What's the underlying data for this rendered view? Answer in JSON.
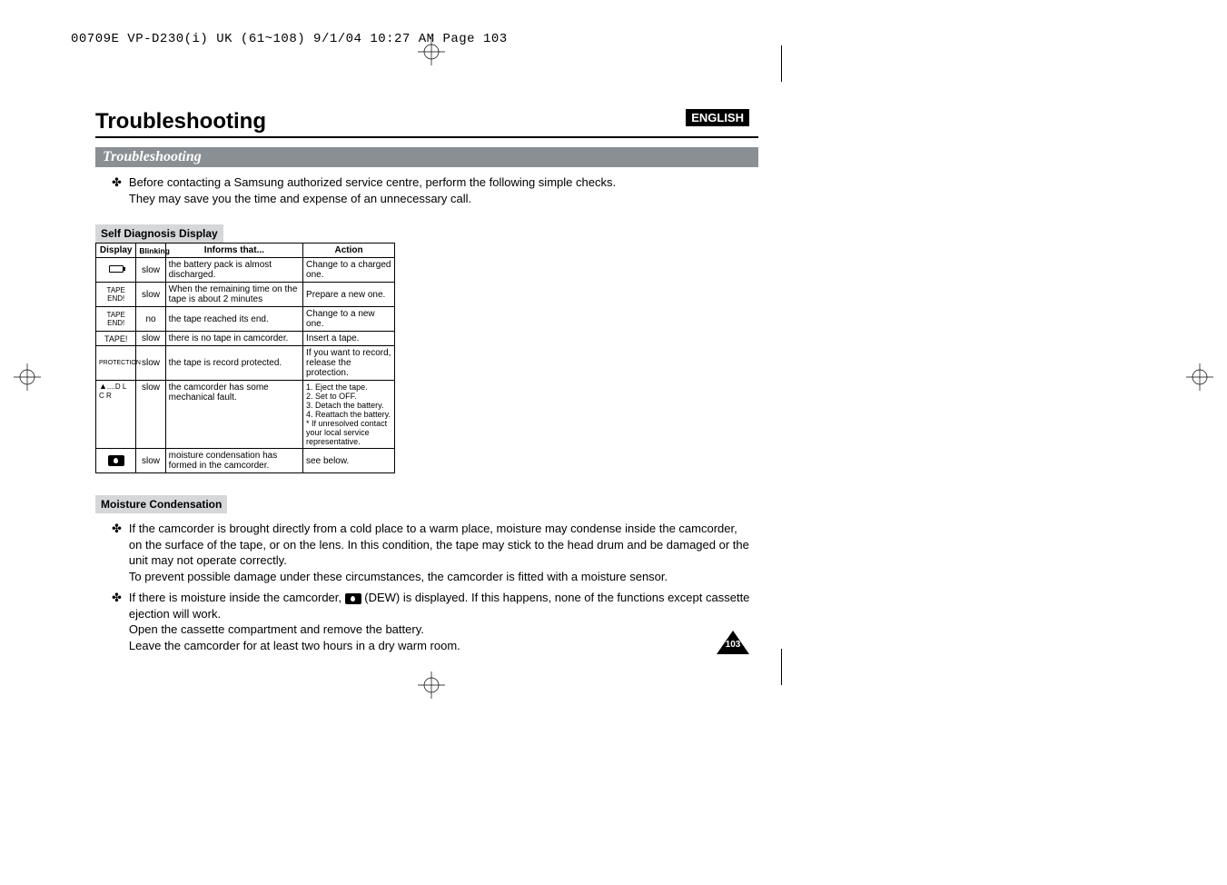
{
  "header_line": "00709E VP-D230(i) UK (61~108)  9/1/04 10:27 AM  Page 103",
  "lang_badge": "ENGLISH",
  "main_title": "Troubleshooting",
  "section_title": "Troubleshooting",
  "intro_line1": "Before contacting a Samsung authorized service centre, perform the following simple checks.",
  "intro_line2": "They may save you the time and expense of an unnecessary call.",
  "self_diag_title": "Self Diagnosis Display",
  "table": {
    "headers": {
      "display": "Display",
      "blinking": "Blinking",
      "informs": "Informs that...",
      "action": "Action"
    },
    "rows": [
      {
        "display_icon": "battery",
        "display_text": "",
        "blinking": "slow",
        "informs": "the battery pack is almost discharged.",
        "action": "Change to a charged one."
      },
      {
        "display_text": "TAPE END!",
        "blinking": "slow",
        "informs": "When the remaining time on the tape is about 2 minutes",
        "action": "Prepare a new one."
      },
      {
        "display_text": "TAPE END!",
        "blinking": "no",
        "informs": "the tape reached its end.",
        "action": "Change to a new one."
      },
      {
        "display_text": "TAPE!",
        "blinking": "slow",
        "informs": "there is no tape in camcorder.",
        "action": "Insert a tape."
      },
      {
        "display_text": "PROTECTION",
        "blinking": "slow",
        "informs": "the tape is record protected.",
        "action": "If you want to record, release the protection."
      },
      {
        "display_icon": "eject",
        "display_text": "....D\nL\nC\nR",
        "blinking": "slow",
        "informs": "the camcorder has some mechanical fault.",
        "action": "1. Eject the tape.\n2. Set to OFF.\n3. Detach the battery.\n4. Reattach the battery.\n* If unresolved contact your local service representative."
      },
      {
        "display_icon": "dew",
        "display_text": "",
        "blinking": "slow",
        "informs": "moisture condensation has formed in the camcorder.",
        "action": "see below."
      }
    ]
  },
  "moisture_title": "Moisture Condensation",
  "moisture_b1_l1": "If the camcorder is brought directly from a cold place to a warm place, moisture may condense inside the camcorder,",
  "moisture_b1_l2": "on the surface of the tape, or on the lens. In this condition, the tape may stick to the head drum and be damaged or the unit may not operate correctly.",
  "moisture_b1_l3": "To prevent possible damage under these circumstances, the camcorder is fitted with a moisture sensor.",
  "moisture_b2_pre": "If there is moisture inside the camcorder, ",
  "moisture_b2_post": " (DEW) is displayed. If this happens, none of the functions except cassette ejection will work.",
  "moisture_b2_l2": "Open the cassette compartment and remove the battery.",
  "moisture_b2_l3": "Leave the camcorder for at least two hours in a dry warm room.",
  "page_number": "103"
}
